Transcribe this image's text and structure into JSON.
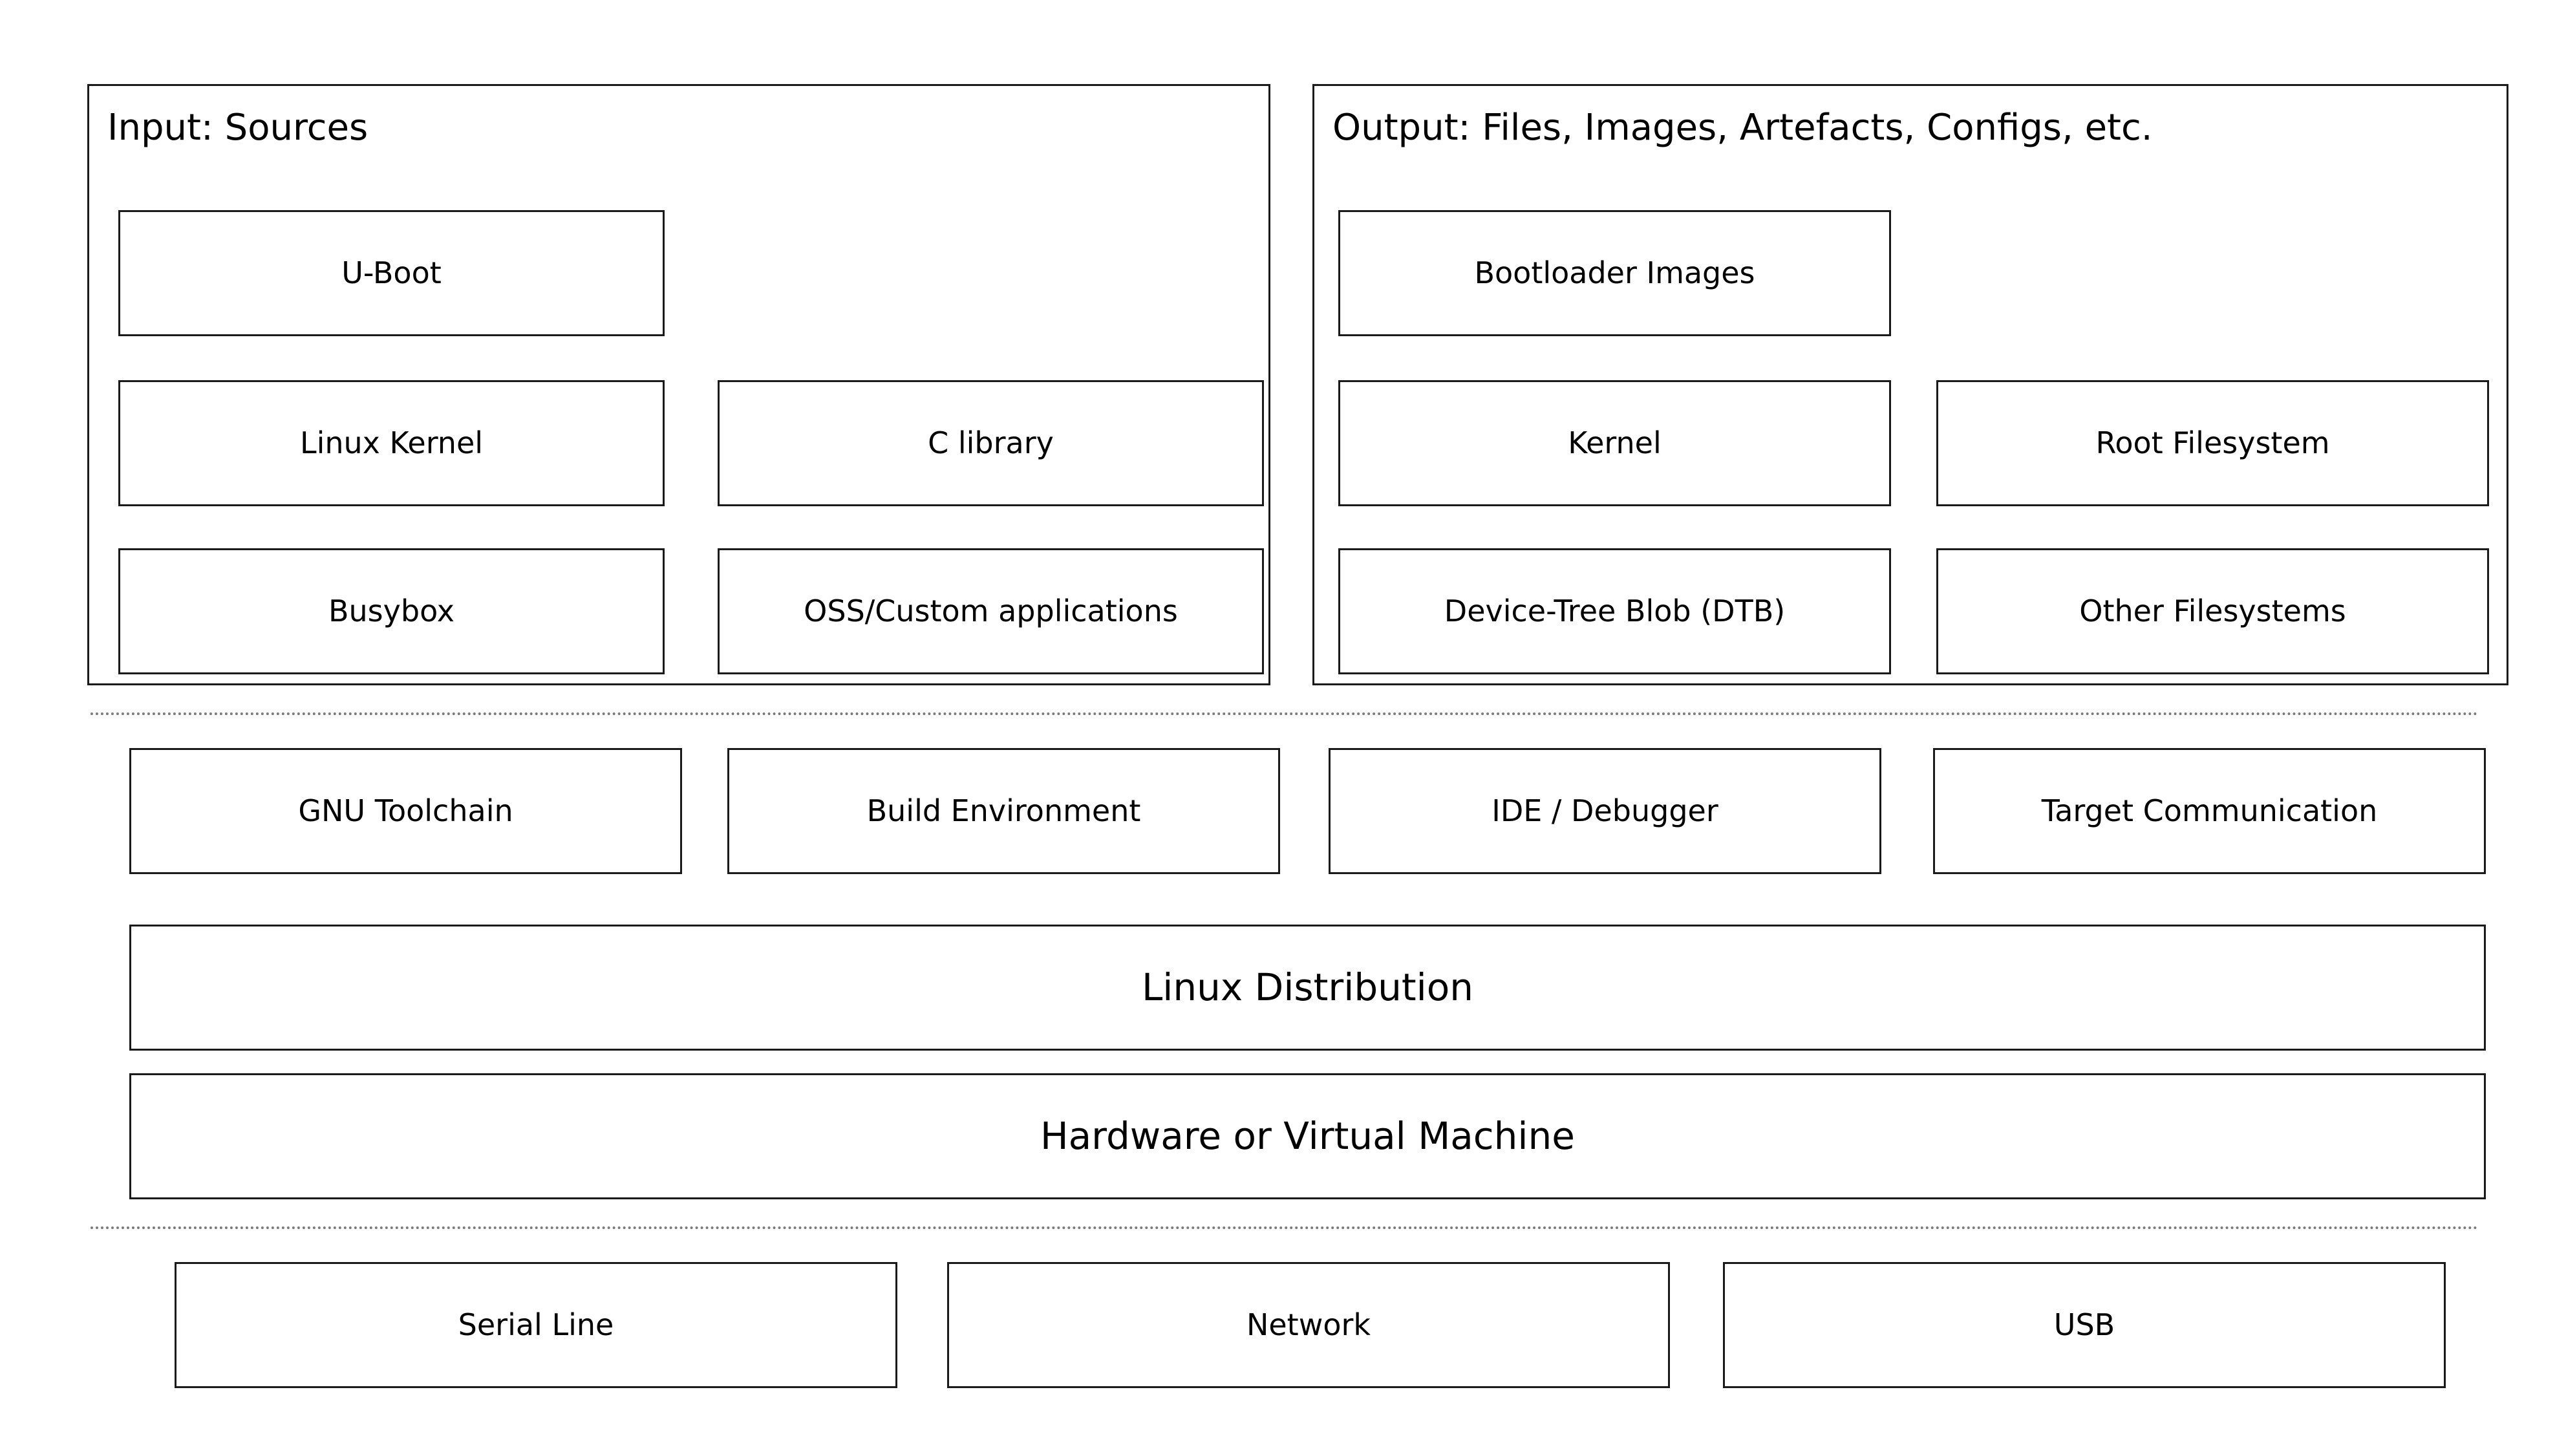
{
  "diagram": {
    "title_input_panel": "Input: Sources",
    "title_output_panel": "Output: Files, Images, Artefacts, Configs, etc.",
    "input_sources": [
      {
        "label": "U-Boot"
      },
      {
        "label": "Linux Kernel"
      },
      {
        "label": "C library"
      },
      {
        "label": "Busybox"
      },
      {
        "label": "OSS/Custom applications"
      }
    ],
    "output_artefacts": [
      {
        "label": "Bootloader Images"
      },
      {
        "label": "Kernel"
      },
      {
        "label": "Root Filesystem"
      },
      {
        "label": "Device-Tree Blob (DTB)"
      },
      {
        "label": "Other Filesystems"
      }
    ],
    "tools": [
      {
        "label": "GNU Toolchain"
      },
      {
        "label": "Build Environment"
      },
      {
        "label": "IDE / Debugger"
      },
      {
        "label": "Target Communication"
      }
    ],
    "platform_layers": [
      {
        "label": "Linux Distribution"
      },
      {
        "label": "Hardware or Virtual Machine"
      }
    ],
    "connections": [
      {
        "label": "Serial Line"
      },
      {
        "label": "Network"
      },
      {
        "label": "USB"
      }
    ],
    "colors": {
      "stroke": "#1a1a1a",
      "separator": "#7a7a7a",
      "background": "#ffffff",
      "text": "#000000"
    }
  }
}
